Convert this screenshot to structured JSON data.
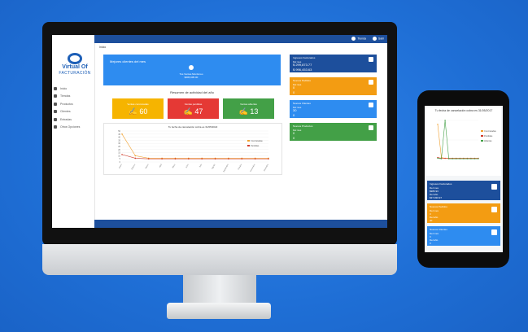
{
  "app": {
    "logo_line1": "Virtual Of",
    "logo_line2": "FACTURACIÓN"
  },
  "topbar": {
    "item1": "Tienda",
    "item2": "Salir"
  },
  "sidebar": {
    "items": [
      {
        "label": "Inicio"
      },
      {
        "label": "Tiendas"
      },
      {
        "label": "Productos"
      },
      {
        "label": "Clientes"
      },
      {
        "label": "Entradas"
      },
      {
        "label": "Otros Opciones"
      }
    ]
  },
  "breadcrumb": "Inicio",
  "welcome": {
    "title": "Mejores clientes del mes",
    "name": "Tus Ventas Monitoreo",
    "amount": "$695,995.00"
  },
  "summary_title": "Resumen de actividad del año",
  "kpis": [
    {
      "label": "Ventas concretadas",
      "value": "60",
      "color": "#f6b400"
    },
    {
      "label": "Ventas perdidas",
      "value": "47",
      "color": "#e53935"
    },
    {
      "label": "Ventas abiertas",
      "value": "13",
      "color": "#43a047"
    }
  ],
  "chart_caption": "Tu fecha de cancelación cobra es 31/05/2022",
  "chart_data": {
    "type": "line",
    "categories": [
      "Enero",
      "Febrero",
      "Marzo",
      "Abril",
      "Mayo",
      "Junio",
      "Julio",
      "Agosto",
      "Septiembre",
      "Octubre",
      "Noviembre",
      "Diciembre"
    ],
    "series": [
      {
        "name": "Concretadas",
        "color": "#f0a030",
        "values": [
          45,
          10,
          6,
          6,
          6,
          6,
          6,
          6,
          6,
          6,
          6,
          6
        ]
      },
      {
        "name": "Perdidas",
        "color": "#d03b2a",
        "values": [
          12,
          6,
          5,
          5,
          5,
          5,
          5,
          5,
          5,
          5,
          5,
          5
        ]
      }
    ],
    "ylim": [
      0,
      50
    ],
    "yticks": [
      0,
      5,
      10,
      15,
      20,
      25,
      30,
      35,
      40,
      45,
      50
    ]
  },
  "right_panels": [
    {
      "title": "Ingresos Facturados",
      "sub": "Del mes",
      "v1": "$ 299,873.77",
      "v2": "$ 996,453.63",
      "color": "#1d4f9c"
    },
    {
      "title": "Nuevos Pedidos",
      "sub": "Del mes",
      "v1": "0",
      "v2": "0",
      "color": "#f39c12"
    },
    {
      "title": "Nuevos Clientes",
      "sub": "Del mes",
      "v1": "30",
      "v2": "0",
      "color": "#2e8cf0"
    },
    {
      "title": "Nuevos Productos",
      "sub": "Del mes",
      "v1": "0",
      "v2": "0",
      "color": "#43a047"
    }
  ],
  "phone": {
    "chart_caption": "Tu fecha de cancelación cobra es 31/05/2017",
    "chart_data": {
      "type": "line",
      "series": [
        {
          "name": "Concretadas",
          "color": "#f0a030",
          "values": [
            90,
            5,
            3,
            3,
            3,
            3,
            3,
            3,
            3,
            3,
            3,
            3
          ]
        },
        {
          "name": "Perdidas",
          "color": "#d03b2a",
          "values": [
            5,
            3,
            3,
            3,
            3,
            3,
            3,
            3,
            3,
            3,
            3,
            3
          ]
        },
        {
          "name": "Abiertas",
          "color": "#43a047",
          "values": [
            3,
            2,
            100,
            2,
            2,
            2,
            2,
            2,
            2,
            2,
            2,
            2
          ]
        }
      ],
      "ylim": [
        0,
        100
      ]
    },
    "panels": [
      {
        "title": "Ingresos Facturados",
        "a": "Del mes",
        "b": "$986.93",
        "c": "Del año",
        "d": "$37,930.97",
        "color": "#1d4f9c"
      },
      {
        "title": "Nuevos Pedidos",
        "a": "Del mes",
        "b": "3",
        "c": "Del año",
        "d": "30",
        "color": "#f39c12"
      },
      {
        "title": "Nuevos Clientes",
        "a": "Del mes",
        "b": "0",
        "c": "Del año",
        "d": "0",
        "color": "#2e8cf0"
      }
    ]
  }
}
